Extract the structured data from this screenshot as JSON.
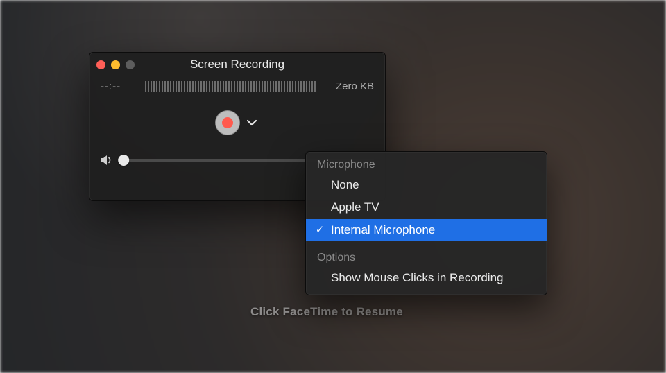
{
  "window": {
    "title": "Screen Recording",
    "timer": "--:--",
    "size": "Zero KB"
  },
  "menu": {
    "microphone": {
      "label": "Microphone",
      "items": [
        {
          "label": "None",
          "checked": false
        },
        {
          "label": "Apple TV",
          "checked": false
        },
        {
          "label": "Internal Microphone",
          "checked": true
        }
      ]
    },
    "options": {
      "label": "Options",
      "items": [
        {
          "label": "Show Mouse Clicks in Recording",
          "checked": false
        }
      ]
    }
  },
  "background": {
    "hint": "Click FaceTime to Resume"
  }
}
